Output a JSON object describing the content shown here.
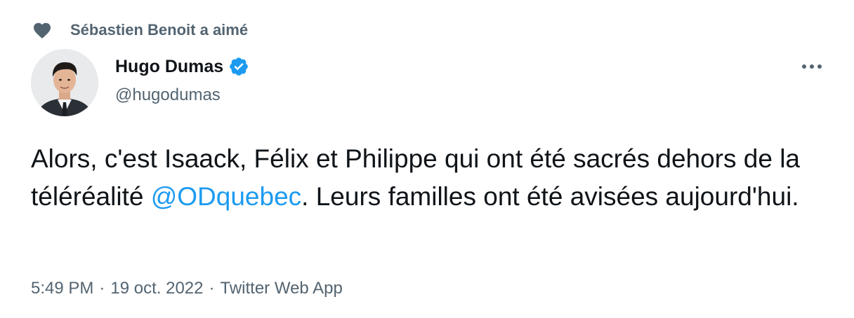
{
  "social_context": {
    "icon": "heart-icon",
    "text": "Sébastien Benoit a aimé"
  },
  "author": {
    "name": "Hugo Dumas",
    "handle": "@hugodumas",
    "verified": true,
    "verified_color": "#1d9bf0"
  },
  "more_icon": "more-horizontal-icon",
  "tweet": {
    "text_before": "Alors, c'est Isaack, Félix et Philippe qui ont été sacrés dehors de la téléréalité ",
    "mention": "@ODquebec",
    "text_after": ". Leurs familles ont été avisées aujourd'hui."
  },
  "meta": {
    "time": "5:49 PM",
    "separator": "·",
    "date": "19 oct. 2022",
    "source": "Twitter Web App"
  },
  "colors": {
    "text": "#0f1419",
    "secondary": "#536471",
    "link": "#1d9bf0"
  }
}
